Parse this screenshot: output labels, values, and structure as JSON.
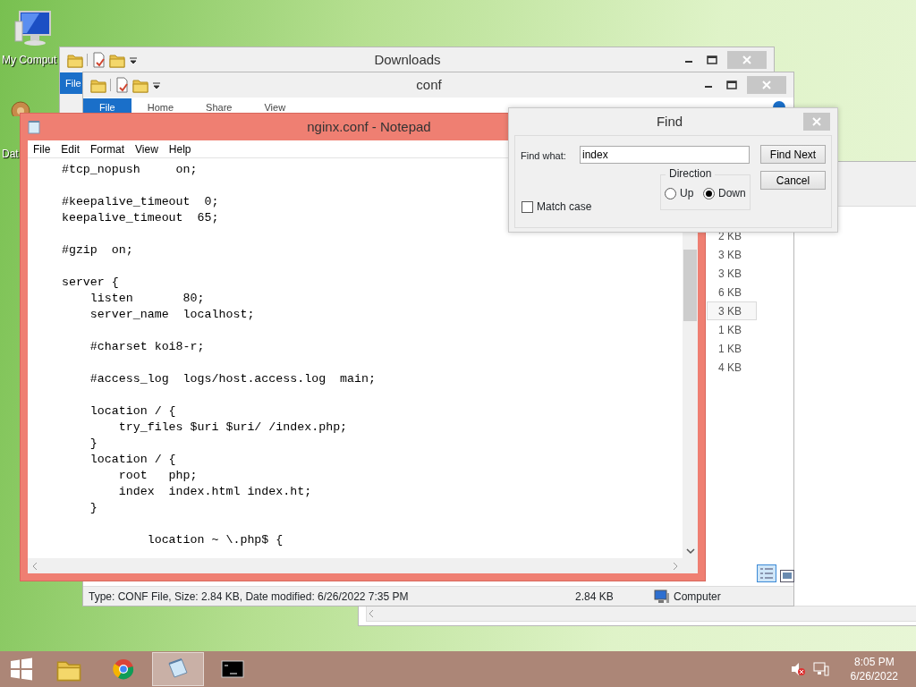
{
  "desktop_icons": [
    {
      "label": "My Comput"
    },
    {
      "label": "Dat"
    }
  ],
  "downloads_window": {
    "title": "Downloads",
    "ribbon_tabs": [
      {
        "label": "File",
        "kind": "file"
      }
    ]
  },
  "conf_window": {
    "title": "conf",
    "ribbon_tabs": [
      {
        "label": "File",
        "kind": "file"
      },
      {
        "label": "Home",
        "kind": "tab"
      },
      {
        "label": "Share",
        "kind": "tab"
      },
      {
        "label": "View",
        "kind": "tab"
      }
    ],
    "sizes": [
      {
        "text": "2 KB",
        "selected": false
      },
      {
        "text": "3 KB",
        "selected": false
      },
      {
        "text": "3 KB",
        "selected": false
      },
      {
        "text": "6 KB",
        "selected": false
      },
      {
        "text": "3 KB",
        "selected": true
      },
      {
        "text": "1 KB",
        "selected": false
      },
      {
        "text": "1 KB",
        "selected": false
      },
      {
        "text": "4 KB",
        "selected": false
      }
    ],
    "status_bar": {
      "info": "Type: CONF File, Size: 2.84 KB, Date modified: 6/26/2022 7:35 PM",
      "size": "2.84 KB",
      "location": "Computer"
    }
  },
  "notepad": {
    "title": "nginx.conf - Notepad",
    "menu": [
      "File",
      "Edit",
      "Format",
      "View",
      "Help"
    ],
    "text": "    #tcp_nopush     on;\n\n    #keepalive_timeout  0;\n    keepalive_timeout  65;\n\n    #gzip  on;\n\n    server {\n        listen       80;\n        server_name  localhost;\n\n        #charset koi8-r;\n\n        #access_log  logs/host.access.log  main;\n\n        location / {\n            try_files $uri $uri/ /index.php;\n        }\n        location / {\n            root   php;\n            index  index.html index.ht;\n        }\n\n                location ~ \\.php$ {"
  },
  "find_dialog": {
    "title": "Find",
    "find_what_label": "Find what:",
    "find_what_value": "index",
    "match_case": {
      "label": "Match case",
      "checked": false
    },
    "direction": {
      "label": "Direction",
      "options": [
        {
          "label": "Up",
          "selected": false
        },
        {
          "label": "Down",
          "selected": true
        }
      ]
    },
    "buttons": [
      "Find Next",
      "Cancel"
    ]
  },
  "taskbar": {
    "apps": [
      {
        "kind": "explorer",
        "active": false
      },
      {
        "kind": "chrome",
        "active": false
      },
      {
        "kind": "notepad",
        "active": true
      },
      {
        "kind": "console",
        "active": false
      }
    ],
    "clock": {
      "time": "8:05 PM",
      "date": "6/26/2022"
    }
  }
}
